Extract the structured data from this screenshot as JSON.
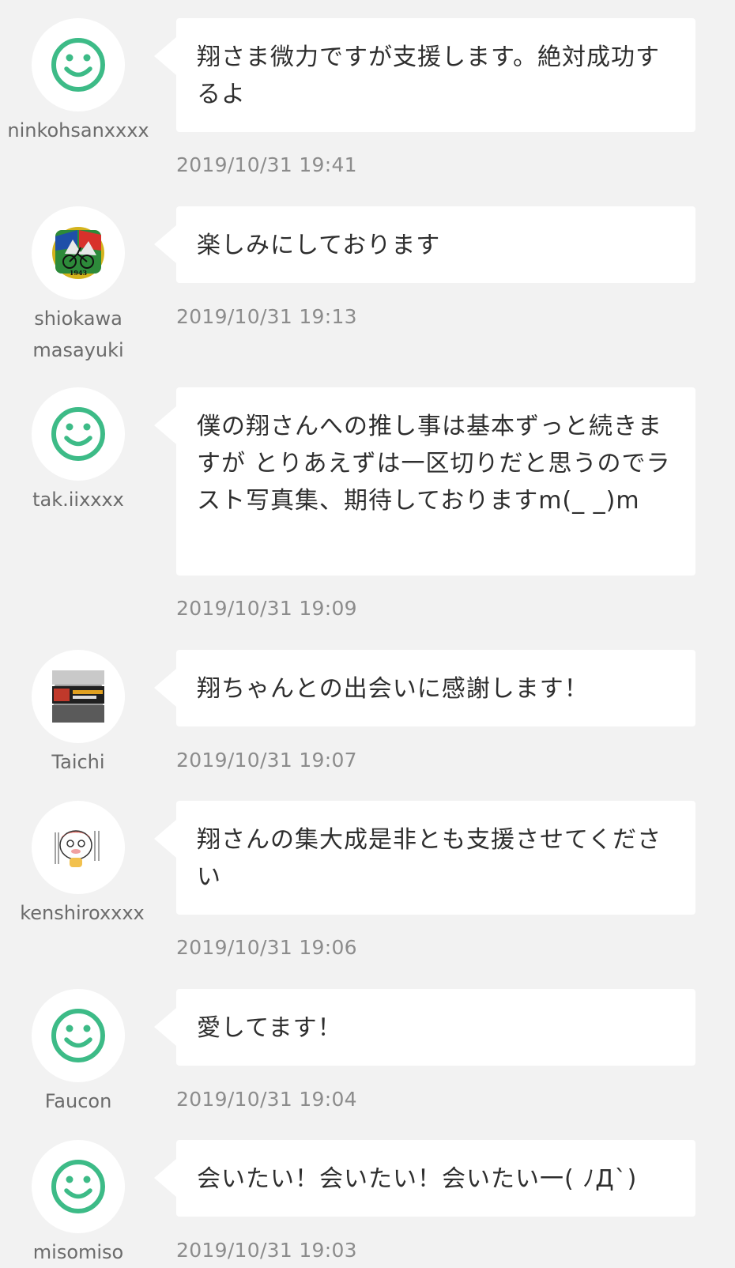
{
  "comments": [
    {
      "username": "ninkohsanxxxx",
      "avatar": "smiley-icon",
      "text": "翔さま微力ですが支援します。絶対成功するよ",
      "time": "2019/10/31 19:41"
    },
    {
      "username": "shiokawa masayuki",
      "avatar": "bicycle-emblem-avatar",
      "avatar_caption": "1943",
      "text": "楽しみにしております",
      "time": "2019/10/31 19:13"
    },
    {
      "username": "tak.iixxxx",
      "avatar": "smiley-icon",
      "text": "僕の翔さんへの推し事は基本ずっと続きますが とりあえずは一区切りだと思うのでラスト写真集、期待しておりますm(_ _)m",
      "time": "2019/10/31 19:09"
    },
    {
      "username": "Taichi",
      "avatar": "train-sign-avatar",
      "text": "翔ちゃんとの出会いに感謝します！",
      "time": "2019/10/31 19:07"
    },
    {
      "username": "kenshiroxxxx",
      "avatar": "cartoon-character-avatar",
      "text": "翔さんの集大成是非とも支援させてください",
      "time": "2019/10/31 19:06"
    },
    {
      "username": "Faucon",
      "avatar": "smiley-icon",
      "text": "愛してます！",
      "time": "2019/10/31 19:04"
    },
    {
      "username": "misomiso",
      "avatar": "smiley-icon",
      "text": "会いたい！会いたい！会いたい一( ﾉД`)",
      "time": "2019/10/31 19:03"
    }
  ],
  "colors": {
    "background": "#f2f2f2",
    "bubble": "#ffffff",
    "smiley": "#3dbb87",
    "username": "#6b6b6b",
    "timestamp": "#8c8c8c",
    "text": "#2e2e2e"
  }
}
